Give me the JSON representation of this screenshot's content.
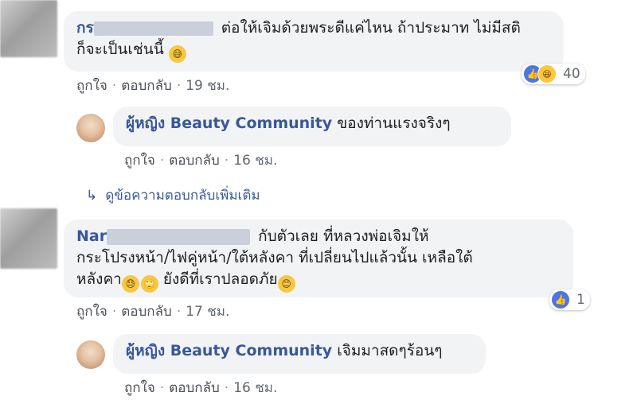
{
  "comments": [
    {
      "author_visible": "กร",
      "text_line1": "ต่อให้เจิมด้วยพระดีแค่ไหน ถ้าประมาท ไม่มีสติ",
      "text_line2": "ก็จะเป็นเช่นนี้",
      "emoji": "😅",
      "like_label": "ถูกใจ",
      "reply_label": "ตอบกลับ",
      "time": "19 ชม.",
      "reactions": {
        "icons": [
          "like-icon",
          "haha-icon"
        ],
        "count": "40"
      }
    },
    {
      "author_visible": "Nar",
      "text_line1": "กับตัวเลย ที่หลวงพ่อเจิมให้",
      "text_line2": "กระโปรงหน้า/ไฟคู่หน้า/ใต้หลังคา ที่เปลี่ยนไปแล้วนั้น เหลือใต้",
      "text_line3a": "หลังคา",
      "text_line3b": "ยังดีที่เราปลอดภัย",
      "like_label": "ถูกใจ",
      "reply_label": "ตอบกลับ",
      "time": "17 ชม.",
      "reactions": {
        "icons": [
          "like-icon"
        ],
        "count": "1"
      }
    }
  ],
  "replies": [
    {
      "author": "ผู้หญิง Beauty Community",
      "text": "ของท่านแรงจริงๆ",
      "like_label": "ถูกใจ",
      "reply_label": "ตอบกลับ",
      "time": "16 ชม."
    },
    {
      "author": "ผู้หญิง Beauty Community",
      "text": "เจิมมาสดๆร้อนๆ",
      "like_label": "ถูกใจ",
      "reply_label": "ตอบกลับ",
      "time": "16 ชม."
    }
  ],
  "more_replies_label": "ดูข้อความตอบกลับเพิ่มเติม",
  "colors": {
    "link": "#385898",
    "bubble": "#f2f3f5",
    "meta": "#606770",
    "like": "#4a76e8"
  }
}
